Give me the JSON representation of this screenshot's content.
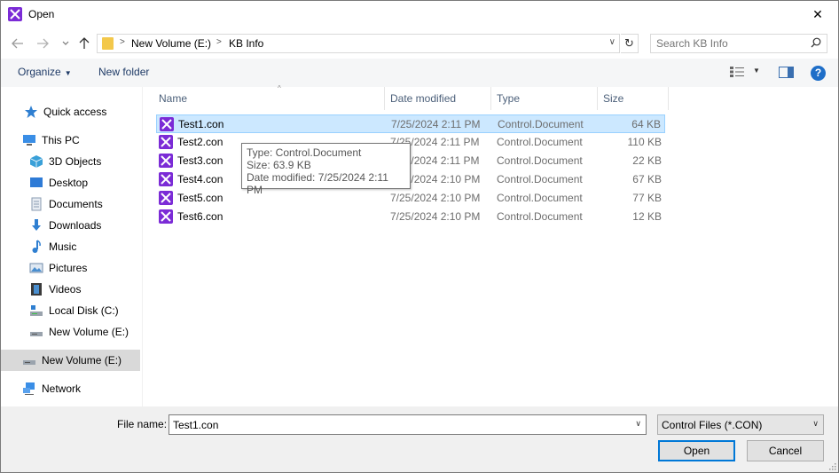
{
  "window": {
    "title": "Open",
    "close_glyph": "✕"
  },
  "address": {
    "segments": [
      "New Volume (E:)",
      "KB Info"
    ],
    "refresh_glyph": "↻"
  },
  "search": {
    "placeholder": "Search KB Info"
  },
  "toolbar": {
    "organize_label": "Organize",
    "new_folder_label": "New folder",
    "help_glyph": "?"
  },
  "sidebar": {
    "items": [
      {
        "label": "Quick access",
        "icon": "star-icon"
      },
      {
        "label": "This PC",
        "icon": "computer-icon"
      },
      {
        "label": "3D Objects",
        "icon": "cube-icon"
      },
      {
        "label": "Desktop",
        "icon": "desktop-icon"
      },
      {
        "label": "Documents",
        "icon": "documents-icon"
      },
      {
        "label": "Downloads",
        "icon": "download-icon"
      },
      {
        "label": "Music",
        "icon": "music-icon"
      },
      {
        "label": "Pictures",
        "icon": "pictures-icon"
      },
      {
        "label": "Videos",
        "icon": "videos-icon"
      },
      {
        "label": "Local Disk (C:)",
        "icon": "drive-icon"
      },
      {
        "label": "New Volume (E:)",
        "icon": "drive-icon"
      },
      {
        "label": "New Volume (E:)",
        "icon": "drive-icon"
      },
      {
        "label": "Network",
        "icon": "network-icon"
      }
    ]
  },
  "columns": {
    "name": "Name",
    "date": "Date modified",
    "type": "Type",
    "size": "Size"
  },
  "files": [
    {
      "name": "Test1.con",
      "date": "7/25/2024 2:11 PM",
      "type": "Control.Document",
      "size": "64 KB"
    },
    {
      "name": "Test2.con",
      "date": "7/25/2024 2:11 PM",
      "type": "Control.Document",
      "size": "110 KB"
    },
    {
      "name": "Test3.con",
      "date": "7/25/2024 2:11 PM",
      "type": "Control.Document",
      "size": "22 KB"
    },
    {
      "name": "Test4.con",
      "date": "7/25/2024 2:10 PM",
      "type": "Control.Document",
      "size": "67 KB"
    },
    {
      "name": "Test5.con",
      "date": "7/25/2024 2:10 PM",
      "type": "Control.Document",
      "size": "77 KB"
    },
    {
      "name": "Test6.con",
      "date": "7/25/2024 2:10 PM",
      "type": "Control.Document",
      "size": "12 KB"
    }
  ],
  "tooltip": {
    "line1": "Type: Control.Document",
    "line2": "Size: 63.9 KB",
    "line3": "Date modified: 7/25/2024 2:11 PM"
  },
  "bottom": {
    "file_name_label": "File name:",
    "file_name_value": "Test1.con",
    "filter_value": "Control Files (*.CON)",
    "open_label": "Open",
    "cancel_label": "Cancel"
  },
  "colors": {
    "app_icon": "#7b2bd6",
    "selection": "#cce8ff",
    "accent": "#0078d7"
  }
}
